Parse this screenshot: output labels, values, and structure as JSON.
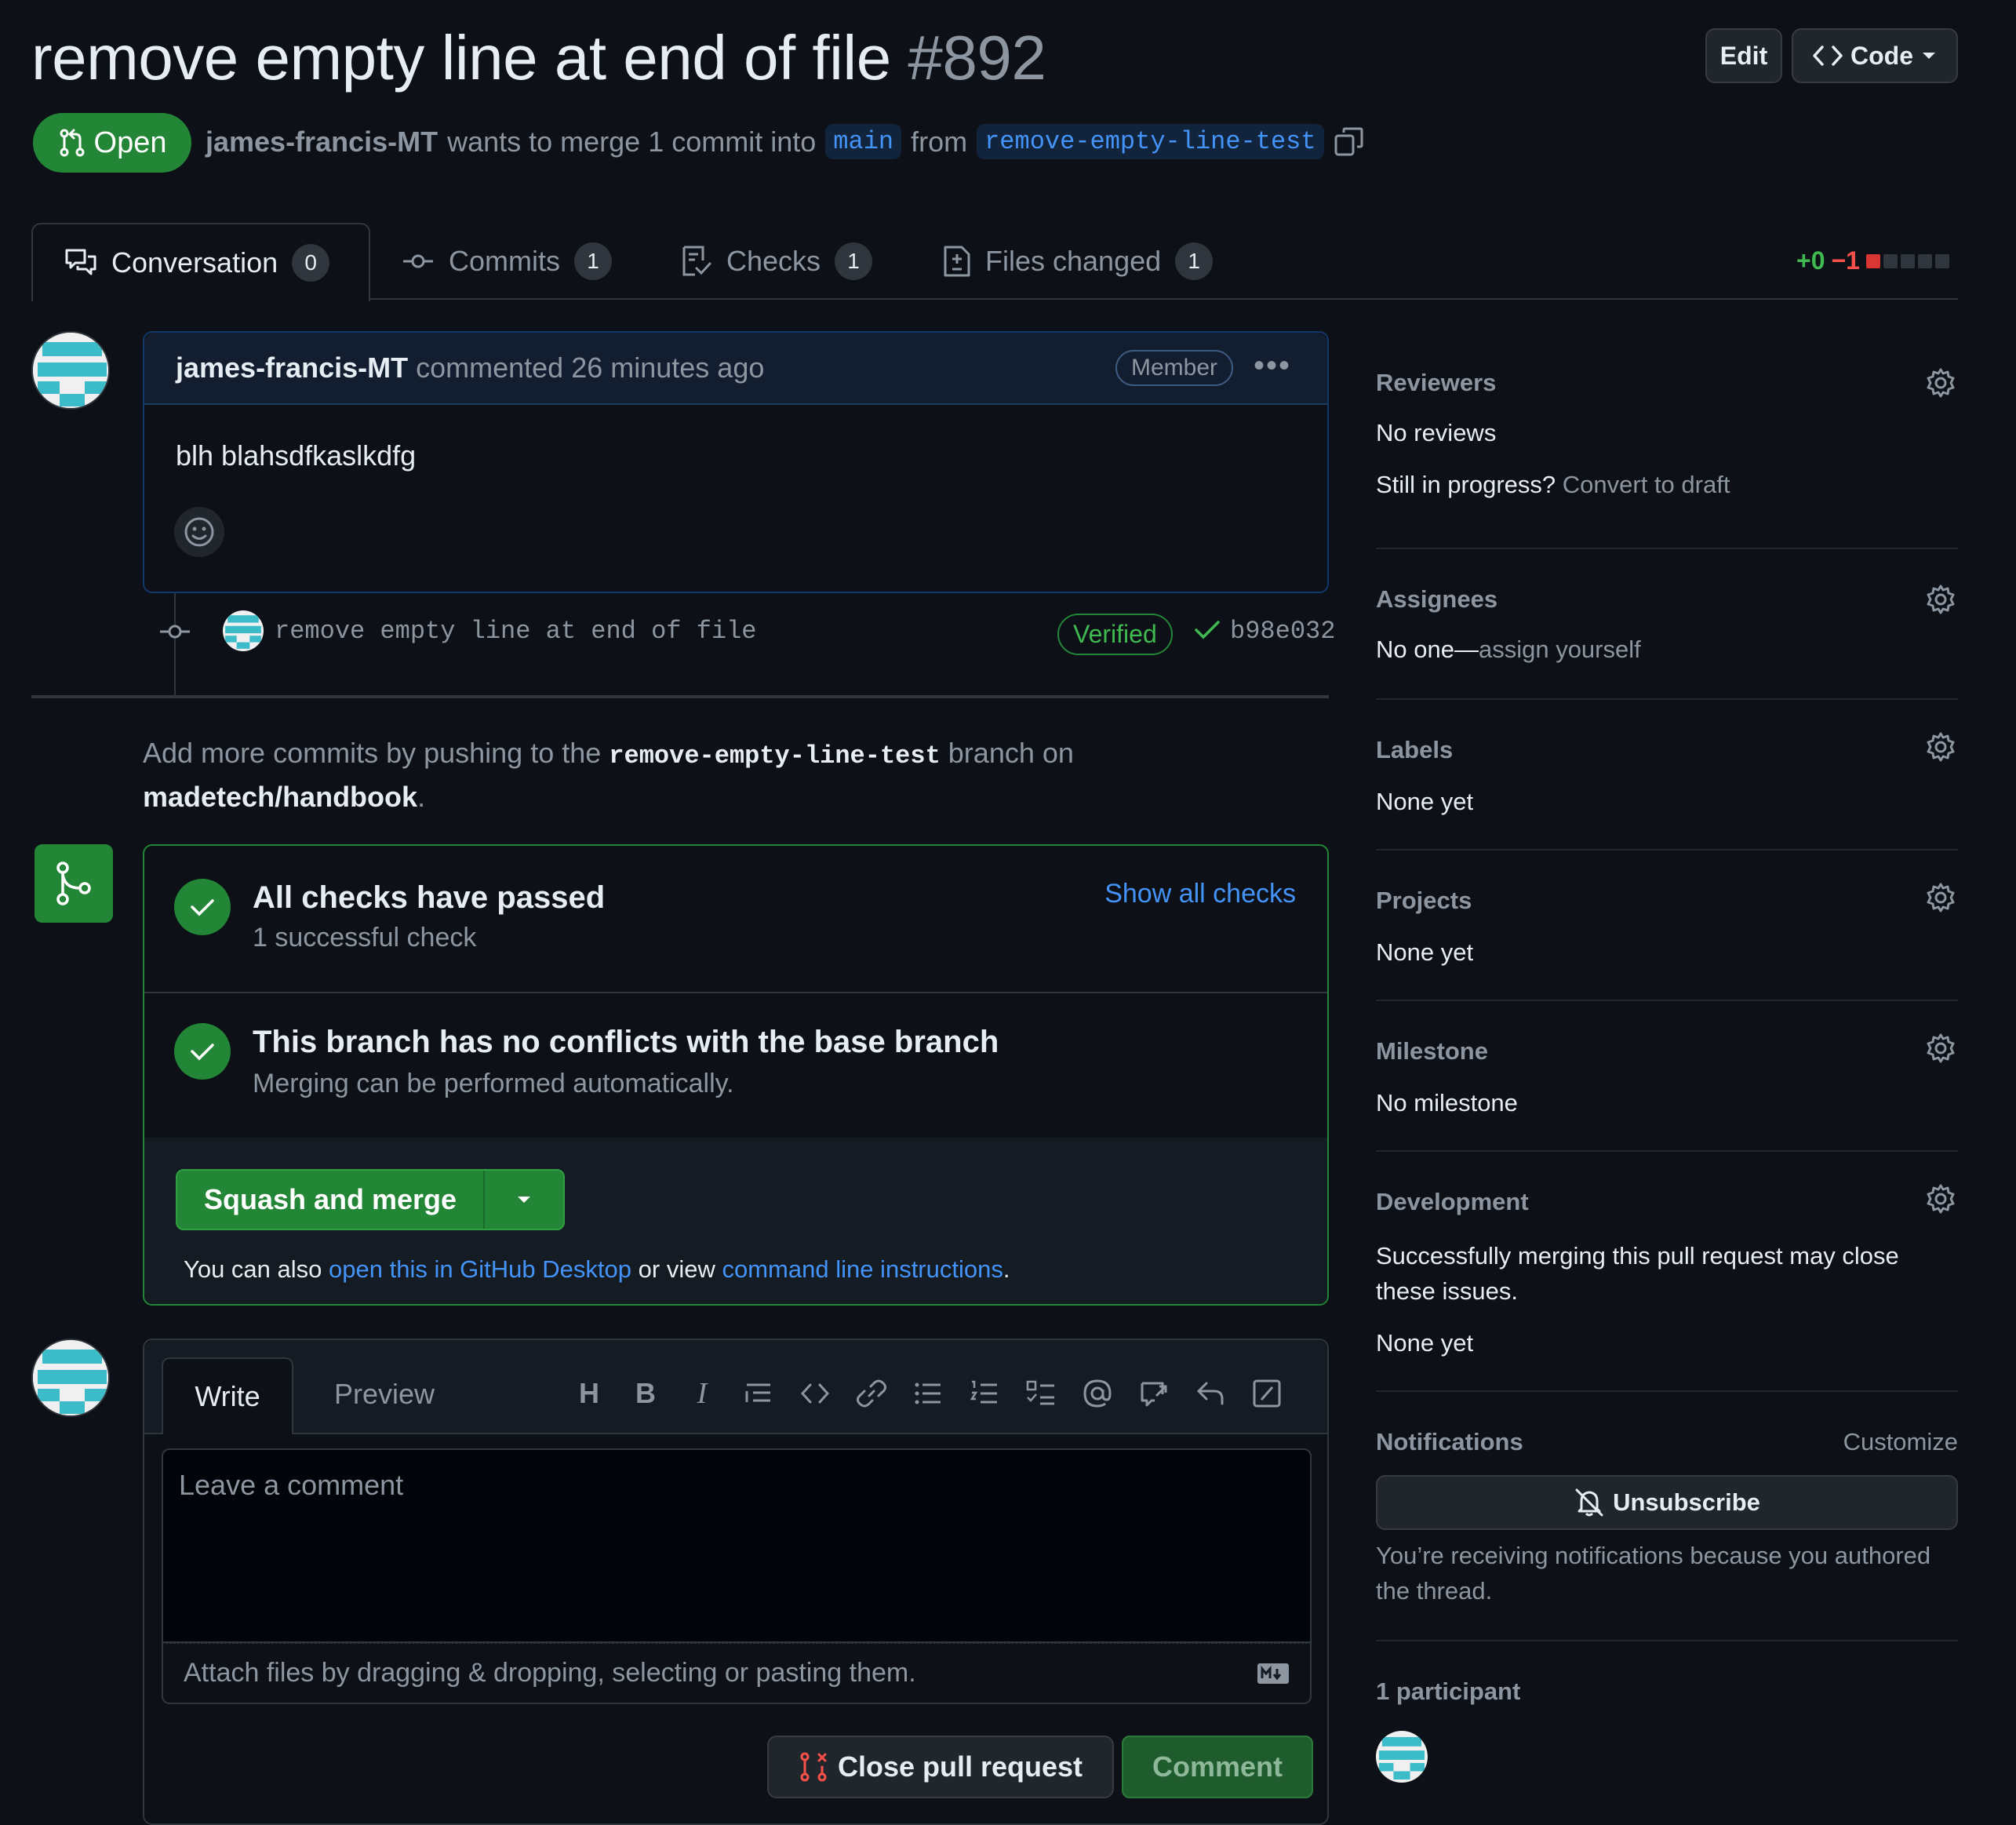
{
  "header": {
    "title": "remove empty line at end of file",
    "number": "#892",
    "edit_label": "Edit",
    "code_label": "Code",
    "state_label": "Open",
    "author": "james-francis-MT",
    "merge_text": "wants to merge 1 commit into",
    "base_branch": "main",
    "from_text": "from",
    "head_branch": "remove-empty-line-test"
  },
  "tabs": [
    {
      "label": "Conversation",
      "count": "0"
    },
    {
      "label": "Commits",
      "count": "1"
    },
    {
      "label": "Checks",
      "count": "1"
    },
    {
      "label": "Files changed",
      "count": "1"
    }
  ],
  "diffstat": {
    "additions": "+0",
    "deletions": "−1"
  },
  "comment": {
    "author": "james-francis-MT",
    "meta": "commented 26 minutes ago",
    "role": "Member",
    "body": "blh blahsdfkaslkdfg"
  },
  "commit": {
    "message": "remove empty line at end of file",
    "verified_label": "Verified",
    "sha": "b98e032"
  },
  "push_hint": {
    "prefix": "Add more commits by pushing to the",
    "branch": "remove-empty-line-test",
    "middle": "branch on",
    "repo": "madetech/handbook",
    "suffix": "."
  },
  "merge": {
    "checks_title": "All checks have passed",
    "checks_sub": "1 successful check",
    "show_all": "Show all checks",
    "conflict_title": "This branch has no conflicts with the base branch",
    "conflict_sub": "Merging can be performed automatically.",
    "merge_button": "Squash and merge",
    "also_prefix": "You can also",
    "desktop_link": "open this in GitHub Desktop",
    "or_view": "or view",
    "cli_link": "command line instructions",
    "period": "."
  },
  "editor": {
    "write_tab": "Write",
    "preview_tab": "Preview",
    "placeholder": "Leave a comment",
    "attach_text": "Attach files by dragging & dropping, selecting or pasting them.",
    "close_button": "Close pull request",
    "comment_button": "Comment"
  },
  "sidebar": {
    "reviewers": {
      "heading": "Reviewers",
      "value": "No reviews",
      "progress_q": "Still in progress?",
      "draft_link": "Convert to draft"
    },
    "assignees": {
      "heading": "Assignees",
      "value": "No one—",
      "assign_link": "assign yourself"
    },
    "labels": {
      "heading": "Labels",
      "value": "None yet"
    },
    "projects": {
      "heading": "Projects",
      "value": "None yet"
    },
    "milestone": {
      "heading": "Milestone",
      "value": "No milestone"
    },
    "development": {
      "heading": "Development",
      "desc_line1": "Successfully merging this pull request may close",
      "desc_line2": "these issues.",
      "value": "None yet"
    },
    "notifications": {
      "heading": "Notifications",
      "customize": "Customize",
      "unsubscribe": "Unsubscribe",
      "reason_line1": "You’re receiving notifications because you authored",
      "reason_line2": "the thread."
    },
    "participants": {
      "heading": "1 participant"
    }
  },
  "colors": {
    "accent_green": "#238636",
    "link_blue": "#4493f8",
    "background": "#0d1117",
    "deletion_red": "#f85149"
  }
}
